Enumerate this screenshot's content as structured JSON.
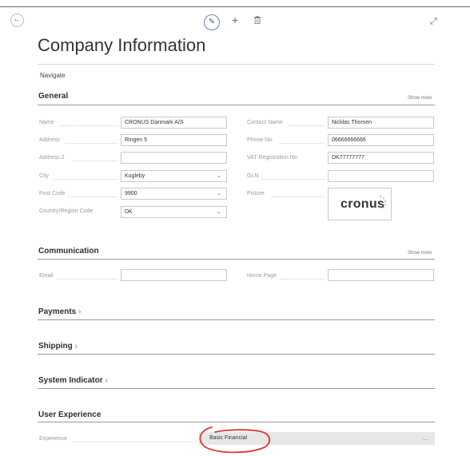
{
  "toolbar": {
    "back_icon": "arrow-left-icon",
    "edit_icon": "pencil-icon",
    "new_icon": "plus-icon",
    "delete_icon": "trash-icon",
    "expand_icon": "expand-icon"
  },
  "page": {
    "title": "Company Information",
    "navigate": "Navigate"
  },
  "general": {
    "title": "General",
    "show_more": "Show more",
    "fields": {
      "name": {
        "label": "Name",
        "value": "CRONUS Danmark A/S"
      },
      "address": {
        "label": "Address",
        "value": "Ringen 5"
      },
      "address2": {
        "label": "Address 2",
        "value": ""
      },
      "city": {
        "label": "City",
        "value": "Kugleby"
      },
      "post_code": {
        "label": "Post Code",
        "value": "9900"
      },
      "country": {
        "label": "Country/Region Code",
        "value": "DK"
      },
      "contact_name": {
        "label": "Contact Name",
        "value": "Nicklas Thorsen"
      },
      "phone": {
        "label": "Phone No.",
        "value": "06666666666"
      },
      "vat": {
        "label": "VAT Registration No.",
        "value": "DK77777777"
      },
      "gln": {
        "label": "GLN",
        "value": ""
      },
      "picture": {
        "label": "Picture",
        "logo": "cronus"
      }
    }
  },
  "communication": {
    "title": "Communication",
    "show_more": "Show more",
    "email": {
      "label": "Email",
      "value": ""
    },
    "home_page": {
      "label": "Home Page",
      "value": ""
    }
  },
  "payments": {
    "title": "Payments"
  },
  "shipping": {
    "title": "Shipping"
  },
  "system_indicator": {
    "title": "System Indicator"
  },
  "user_experience": {
    "title": "User Experience",
    "experience": {
      "label": "Experience",
      "value": "Basic Financial"
    },
    "ellipsis": "..."
  },
  "colors": {
    "annotation": "#d9362f",
    "accent": "#3b5f8a"
  }
}
